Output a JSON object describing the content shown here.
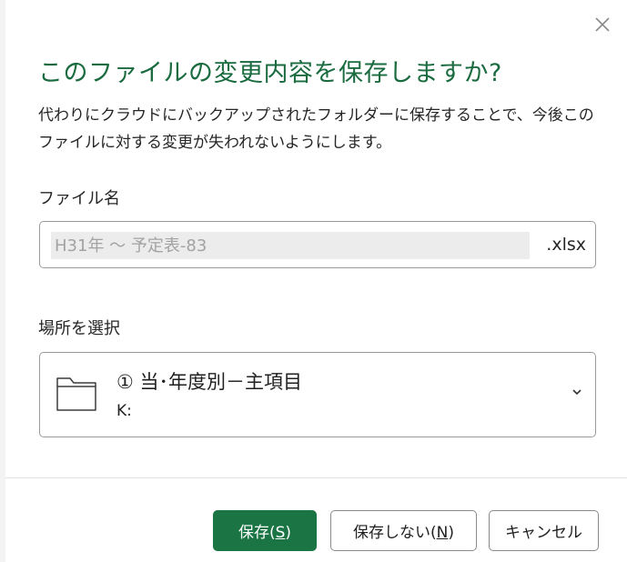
{
  "dialog": {
    "title": "このファイルの変更内容を保存しますか?",
    "description": "代わりにクラウドにバックアップされたフォルダーに保存することで、今後このファイルに対する変更が失われないようにします。",
    "close_icon": "close-icon"
  },
  "filename": {
    "label": "ファイル名",
    "value": "",
    "placeholder": "H31年 ～ 予定表-83",
    "extension": ".xlsx"
  },
  "location": {
    "label": "場所を選択",
    "selected_name": "① 当･年度別－主項目",
    "selected_path": "K:",
    "folder_icon": "folder-icon",
    "chevron_icon": "chevron-down-icon"
  },
  "buttons": {
    "save_prefix": "保存(",
    "save_key": "S",
    "save_suffix": ")",
    "dontsave_prefix": "保存しない(",
    "dontsave_key": "N",
    "dontsave_suffix": ")",
    "cancel_label": "キャンセル"
  },
  "colors": {
    "accent": "#1a7443",
    "title": "#1a6b3f"
  }
}
